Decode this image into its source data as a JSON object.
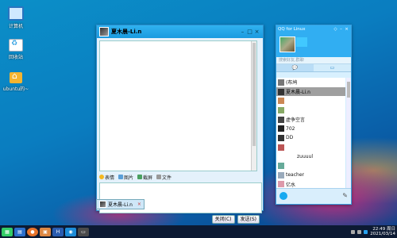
{
  "desktop": {
    "icons": [
      {
        "label": "计算机"
      },
      {
        "label": "回收站"
      },
      {
        "label": "ubuntu的~"
      }
    ]
  },
  "chat_window": {
    "title": "夏木晨-Li.n",
    "toolbar": {
      "emoji": "表情",
      "image": "图片",
      "screenshot": "截屏",
      "file": "文件"
    },
    "close_button": "关闭(C)",
    "send_button": "发送(S)",
    "tab_label": "夏木晨-Li.n"
  },
  "qq_panel": {
    "title": "QQ for Linux",
    "search_placeholder": "搜索好友,群聊",
    "contacts": [
      "(布鸠",
      "夏木晨-Li.n",
      "",
      "",
      "虚争空言",
      "702",
      "DD",
      "",
      "zuuuul",
      "",
      "teacher",
      "亿水"
    ],
    "selected_index": 1
  },
  "taskbar": {
    "time": "22:49 周日",
    "date": "2021/03/14"
  }
}
